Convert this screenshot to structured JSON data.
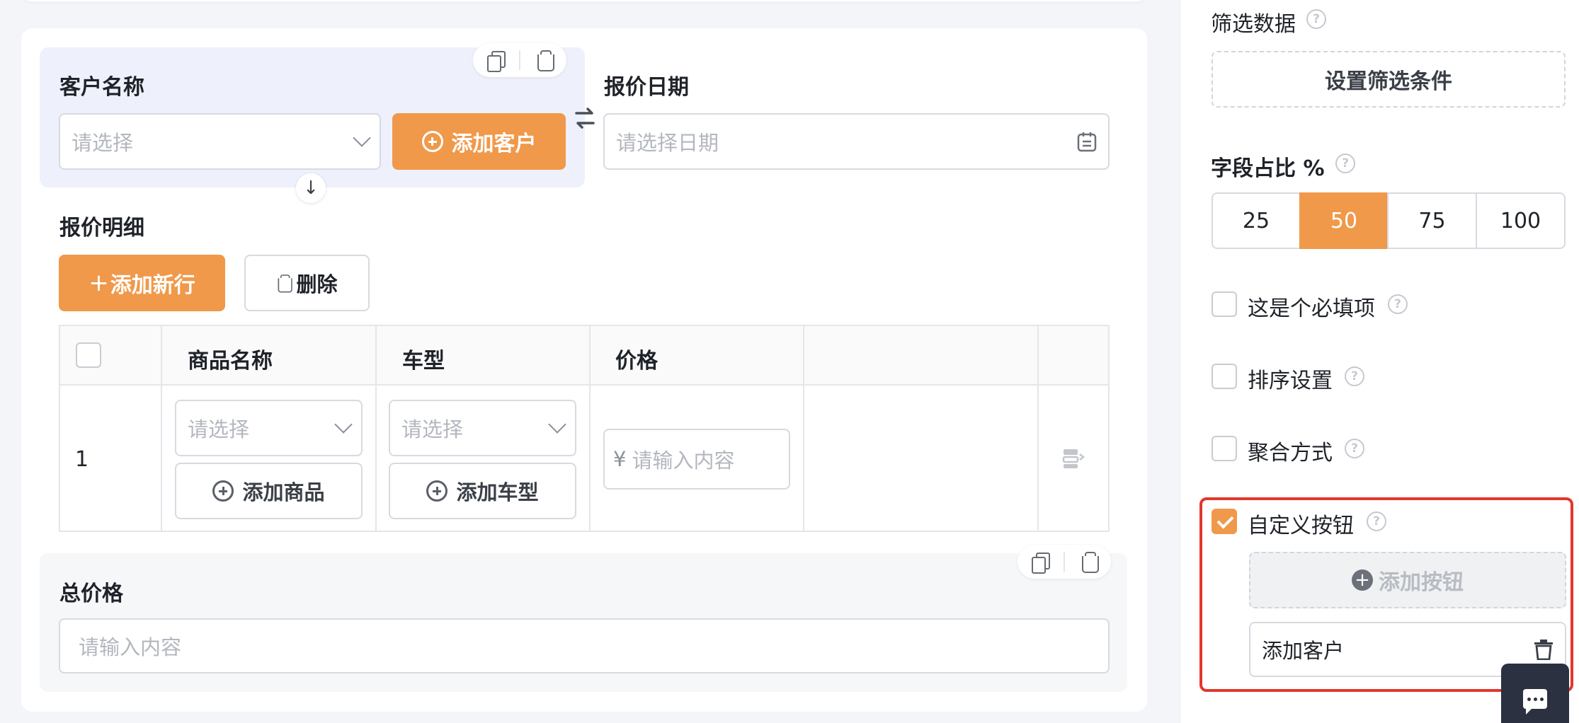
{
  "form": {
    "customer": {
      "label": "客户名称",
      "placeholder": "请选择",
      "add_button": "添加客户"
    },
    "quote_date": {
      "label": "报价日期",
      "placeholder": "请选择日期"
    },
    "details": {
      "label": "报价明细",
      "add_row_button": "添加新行",
      "delete_button": "删除",
      "columns": [
        "商品名称",
        "车型",
        "价格"
      ],
      "rows": [
        {
          "index": "1",
          "product_placeholder": "请选择",
          "product_add": "添加商品",
          "model_placeholder": "请选择",
          "model_add": "添加车型",
          "price_currency": "¥",
          "price_placeholder": "请输入内容"
        }
      ]
    },
    "total": {
      "label": "总价格",
      "placeholder": "请输入内容"
    }
  },
  "panel": {
    "filter": {
      "label": "筛选数据",
      "button": "设置筛选条件"
    },
    "width_ratio": {
      "label": "字段占比 %",
      "options": [
        "25",
        "50",
        "75",
        "100"
      ],
      "selected": "50"
    },
    "required": {
      "label": "这是个必填项",
      "checked": false
    },
    "sort": {
      "label": "排序设置",
      "checked": false
    },
    "aggregate": {
      "label": "聚合方式",
      "checked": false
    },
    "custom_button": {
      "label": "自定义按钮",
      "checked": true,
      "add_button": "添加按钮",
      "items": [
        "添加客户"
      ]
    }
  },
  "colors": {
    "accent": "#f0994a",
    "highlight": "#e2372c",
    "chat_bg": "#2b3140"
  },
  "icons": {
    "copy": "copy-icon",
    "trash": "trash-icon",
    "swap": "swap-icon",
    "arrow_down": "arrow-down-icon",
    "calendar": "calendar-icon",
    "chevron": "chevron-down-icon",
    "plus_circle": "plus-circle-icon",
    "help": "help-icon",
    "chat": "chat-icon"
  }
}
